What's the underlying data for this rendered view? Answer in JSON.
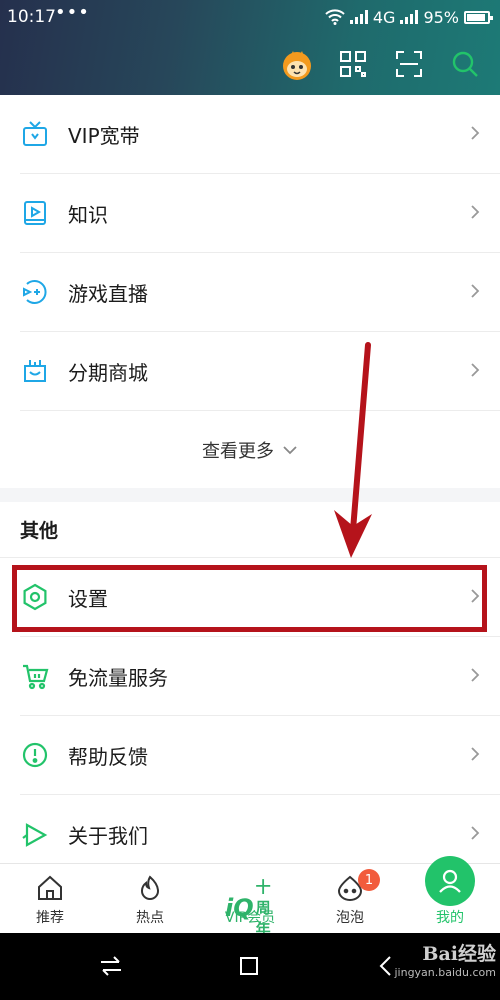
{
  "status_bar": {
    "time": "10:17",
    "dots": "•••",
    "network": "4G",
    "battery": "95%"
  },
  "header": {
    "icons": [
      "avatar-icon",
      "qr-code-icon",
      "scan-icon",
      "search-icon"
    ],
    "accent": "#22c36a"
  },
  "menu_items": [
    {
      "label": "VIP宽带",
      "icon": "broadband-icon"
    },
    {
      "label": "知识",
      "icon": "knowledge-icon"
    },
    {
      "label": "游戏直播",
      "icon": "game-live-icon"
    },
    {
      "label": "分期商城",
      "icon": "installment-mall-icon"
    }
  ],
  "see_more": "查看更多",
  "section_other": {
    "title": "其他",
    "items": [
      {
        "label": "设置",
        "icon": "settings-icon"
      },
      {
        "label": "免流量服务",
        "icon": "free-data-cart-icon"
      },
      {
        "label": "帮助反馈",
        "icon": "help-feedback-icon"
      },
      {
        "label": "关于我们",
        "icon": "about-us-icon"
      }
    ]
  },
  "annotation": {
    "color": "#b5131b"
  },
  "bottom_nav": {
    "items": [
      {
        "label": "推荐",
        "icon": "home-icon"
      },
      {
        "label": "热点",
        "icon": "flame-icon"
      },
      {
        "label": "VIP会员",
        "icon": "vip-10th-anniversary-logo"
      },
      {
        "label": "泡泡",
        "icon": "bubble-face-icon",
        "badge": "1"
      },
      {
        "label": "我的",
        "icon": "user-icon"
      }
    ],
    "vip_logo_text": "iQ",
    "vip_logo_sub": "十周年"
  },
  "watermark": {
    "text": "Bai经验",
    "url": "jingyan.baidu.com"
  }
}
